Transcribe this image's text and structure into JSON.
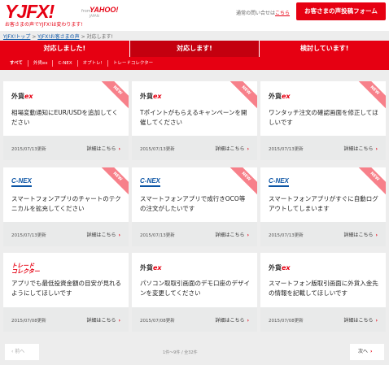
{
  "header": {
    "logo": "YJFX!",
    "logo_from": "from",
    "logo_yahoo": "YAHOO!",
    "logo_sub": "JAPAN",
    "tagline": "お客さまの声でYJFX!は変わります!",
    "inquiry_text": "通常の問い合せは",
    "inquiry_link": "こちら",
    "post_button": "お客さまの声投稿フォーム"
  },
  "breadcrumb": {
    "home": "YJFX!トップ",
    "sep1": " > ",
    "voices": "YJFX!お客さまの声",
    "sep2": " > ",
    "current": "対応します!"
  },
  "status_tabs": [
    "対応しました!",
    "対応します!",
    "検討しています!"
  ],
  "categories": [
    "すべて",
    "外貨ex",
    "C-NEX",
    "オプトレ!",
    "トレードコレクター"
  ],
  "common": {
    "detail": "詳細はこちら",
    "arrow": "›",
    "new_badge": "NEW"
  },
  "cards": [
    {
      "logo_main": "外貨",
      "logo_ex": "ex",
      "title": "相場変動通知にEUR/USDを追加してください",
      "date": "2015/07/13更新"
    },
    {
      "logo_main": "外貨",
      "logo_ex": "ex",
      "title": "Tポイントがもらえるキャンペーンを開催してください",
      "date": "2015/07/13更新"
    },
    {
      "logo_main": "外貨",
      "logo_ex": "ex",
      "title": "ワンタッチ注文の確認画面を修正してほしいです",
      "date": "2015/07/13更新"
    },
    {
      "logo": "C-NEX",
      "title": "スマートフォンアプリのチャートのテクニカルを拡充してください",
      "date": "2015/07/13更新"
    },
    {
      "logo": "C-NEX",
      "title": "スマートフォンアプリで成行きOCO等の注文がしたいです",
      "date": "2015/07/13更新"
    },
    {
      "logo": "C-NEX",
      "title": "スマートフォンアプリがすぐに自動ログアウトしてしまいます",
      "date": "2015/07/13更新"
    },
    {
      "logo_line1": "トレード",
      "logo_line2": "コレクター",
      "title": "アプリでも最低投資金額の目安が見れるようにしてほしいです",
      "date": "2015/07/08更新"
    },
    {
      "logo_main": "外貨",
      "logo_ex": "ex",
      "title": "パソコン取取引画面のデモ口座のデザインを変更してください",
      "date": "2015/07/08更新"
    },
    {
      "logo_main": "外貨",
      "logo_ex": "ex",
      "title": "スマートフォン版取引画面に外貨入金先の情報を記載してほしいです",
      "date": "2015/07/08更新"
    }
  ],
  "pager": {
    "prev": "‹ 前へ",
    "info": "1件～9件 / 全32件",
    "next": "次へ"
  },
  "colors": {
    "accent": "#e60012",
    "accent_dark": "#c4000f",
    "ribbon": "#f7808a",
    "link": "#0c55a5"
  }
}
